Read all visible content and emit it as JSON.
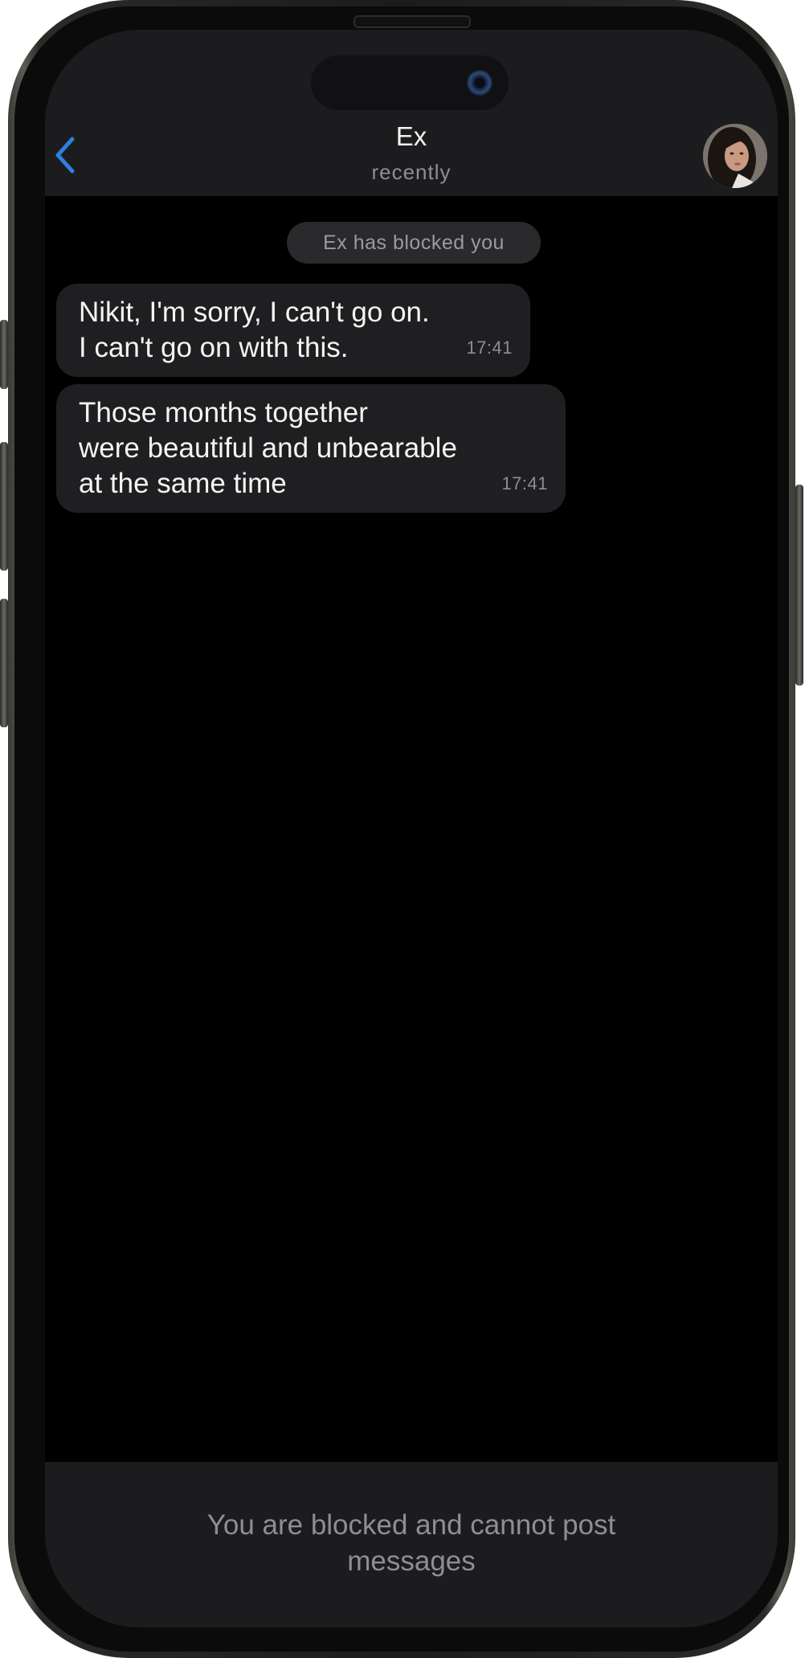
{
  "header": {
    "title": "Ex",
    "status": "recently",
    "back_icon": "chevron-left-icon",
    "accent_color": "#2f7fe0"
  },
  "system_notice": "Ex has blocked you",
  "messages": [
    {
      "text": "Nikit, I'm sorry, I can't go on.\nI can't go on with this.",
      "time": "17:41"
    },
    {
      "text": "Those months together\nwere beautiful and unbearable\nat the same time",
      "time": "17:41"
    }
  ],
  "footer": {
    "blocked_text": "You are blocked and cannot post messages"
  }
}
